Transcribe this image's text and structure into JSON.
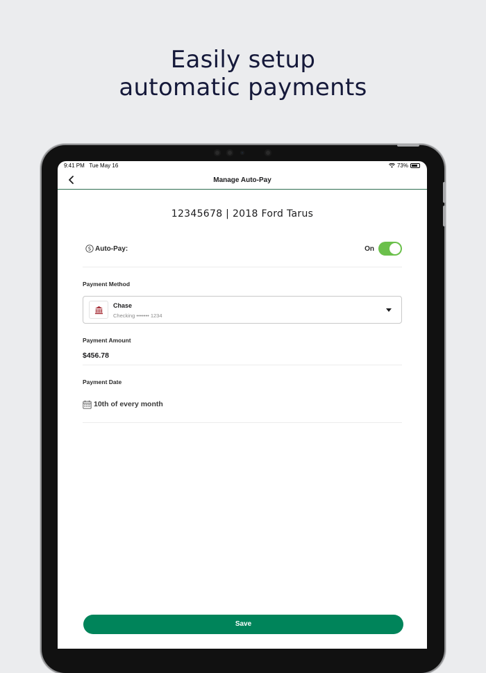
{
  "promo": {
    "headline_line1": "Easily setup",
    "headline_line2": "automatic payments"
  },
  "status_bar": {
    "time": "9:41 PM",
    "date": "Tue May 16",
    "battery": "73%"
  },
  "navbar": {
    "title": "Manage Auto-Pay",
    "back_icon": "chevron-left-icon"
  },
  "vehicle": {
    "label": "12345678 | 2018 Ford Tarus"
  },
  "autopay": {
    "label": "Auto-Pay:",
    "icon": "dollar-circle-icon",
    "state_label": "On",
    "enabled": true
  },
  "payment_method": {
    "section_label": "Payment Method",
    "bank_name": "Chase",
    "account": "Checking ••••••• 1234",
    "icon": "bank-icon"
  },
  "payment_amount": {
    "section_label": "Payment Amount",
    "value": "$456.78"
  },
  "payment_date": {
    "section_label": "Payment Date",
    "value": "10th of every month",
    "icon": "calendar-icon"
  },
  "actions": {
    "save_label": "Save"
  },
  "colors": {
    "background": "#ebecee",
    "headline": "#15193a",
    "toggle_on": "#6bc04b",
    "save_button": "#00845a",
    "bank_icon": "#a8323a",
    "nav_divider": "#2e6e50"
  }
}
